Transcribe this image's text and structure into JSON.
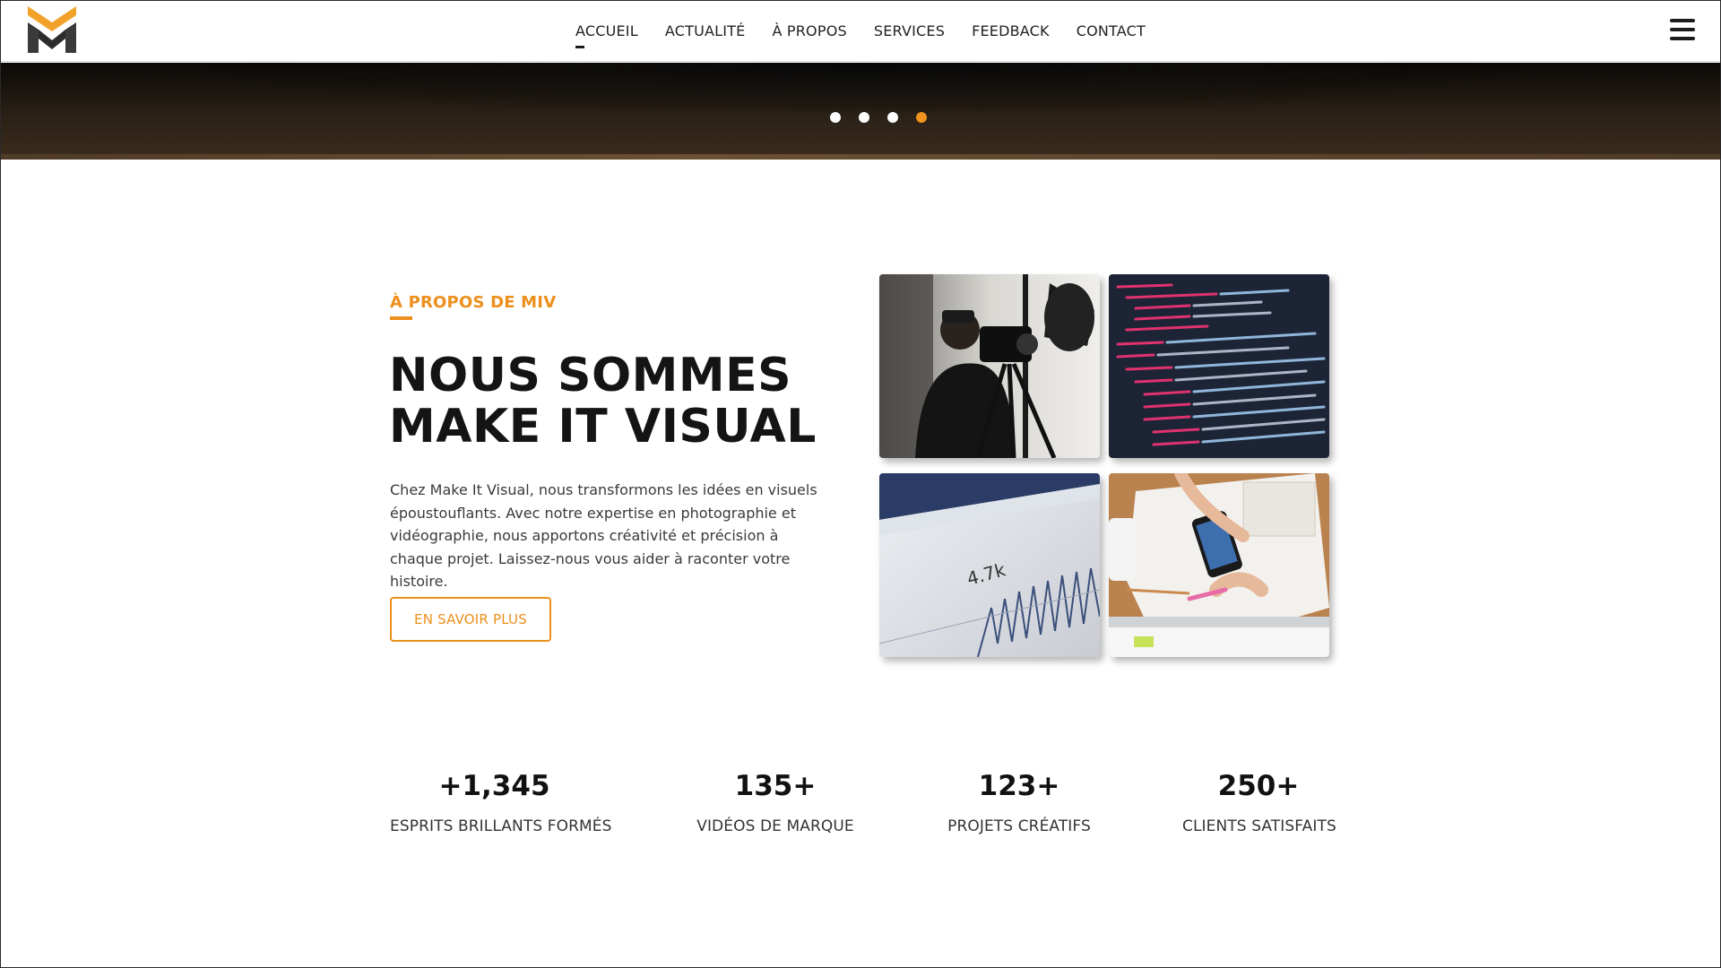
{
  "brand": {
    "logo_icon": "miv-logo-icon",
    "accent": "#ec8f1c",
    "dark": "#1c1c1c"
  },
  "nav": {
    "items": [
      {
        "label": "ACCUEIL",
        "active": true
      },
      {
        "label": "ACTUALITÉ",
        "active": false
      },
      {
        "label": "À PROPOS",
        "active": false
      },
      {
        "label": "SERVICES",
        "active": false
      },
      {
        "label": "FEEDBACK",
        "active": false
      },
      {
        "label": "CONTACT",
        "active": false
      }
    ],
    "menu_icon": "hamburger-menu-icon"
  },
  "hero": {
    "slides_count": 4,
    "active_slide": 4
  },
  "about": {
    "label": "À PROPOS DE MIV",
    "title_line1": "NOUS SOMMES",
    "title_line2": "MAKE IT VISUAL",
    "text": "Chez Make It Visual, nous transformons les idées en visuels époustouflants. Avec notre expertise en photographie et vidéographie, nous apportons créativité et précision à chaque projet. Laissez-nous vous aider à raconter votre histoire.",
    "button_label": "EN SAVOIR PLUS"
  },
  "gallery": {
    "tiles": [
      {
        "image": "videographer-with-camera"
      },
      {
        "image": "code-on-screen"
      },
      {
        "image": "analytics-dashboard",
        "visible_value": "4.7k"
      },
      {
        "image": "designer-sketching-with-phone"
      }
    ]
  },
  "stats": [
    {
      "number": "+1,345",
      "label": "ESPRITS BRILLANTS FORMÉS"
    },
    {
      "number": "135+",
      "label": "VIDÉOS DE MARQUE"
    },
    {
      "number": "123+",
      "label": "PROJETS CRÉATIFS"
    },
    {
      "number": "250+",
      "label": "CLIENTS SATISFAITS"
    }
  ]
}
